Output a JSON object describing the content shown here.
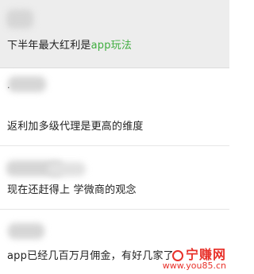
{
  "messages": [
    {
      "text_prefix": "下半年最大红利是",
      "text_highlight": "app玩法"
    },
    {
      "dot": "·",
      "text": "返利加多级代理是更高的维度"
    },
    {
      "text": "现在还赶得上  学微商的观念"
    },
    {
      "text": "app已经几百万月佣金，有好几家了"
    }
  ],
  "watermark": {
    "brand": "宁赚网",
    "url": "www.you85.cn"
  },
  "colors": {
    "highlight": "#3fae3f",
    "watermark": "#e8312a"
  }
}
